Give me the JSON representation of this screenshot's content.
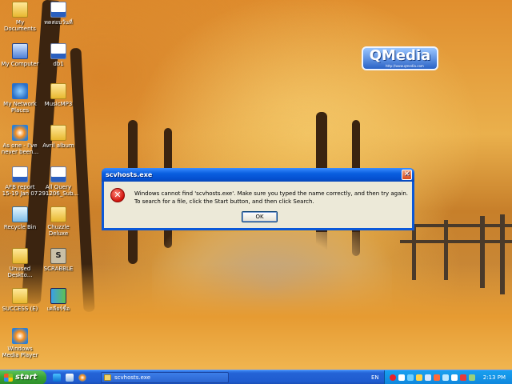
{
  "desktop": {
    "icons_left": [
      {
        "label": "My Documents",
        "icon": "folder-icon"
      },
      {
        "label": "My Computer",
        "icon": "computer-icon"
      },
      {
        "label": "My Network Places",
        "icon": "network-icon"
      },
      {
        "label": "As one - I've never been...",
        "icon": "media-file-icon"
      },
      {
        "label": "AFB report 15-19 Jan 07",
        "icon": "document-icon"
      },
      {
        "label": "Recycle Bin",
        "icon": "recycle-bin-icon"
      },
      {
        "label": "Unused Deskto...",
        "icon": "folder-icon"
      },
      {
        "label": "SUCCESS (E)",
        "icon": "folder-icon"
      },
      {
        "label": "Windows Media Player",
        "icon": "windows-media-player-icon"
      }
    ],
    "icons_right": [
      {
        "label": "ทดสอบวันที่",
        "icon": "document-icon"
      },
      {
        "label": "db1",
        "icon": "document-icon"
      },
      {
        "label": "MusicMP3",
        "icon": "folder-icon"
      },
      {
        "label": "Avril album",
        "icon": "folder-icon"
      },
      {
        "label": "All Query 291206_Sub...",
        "icon": "document-icon"
      },
      {
        "label": "Chuzzle Deluxe",
        "icon": "folder-icon"
      },
      {
        "label": "SCRABBLE",
        "icon": "scrabble-icon"
      },
      {
        "label": "เคลียร์ชื่อ",
        "icon": "app-icon"
      }
    ],
    "logo": {
      "text": "QMedia",
      "subtext": "http://www.qmedia.com"
    }
  },
  "dialog": {
    "title": "scvhosts.exe",
    "message": "Windows cannot find 'scvhosts.exe'. Make sure you typed the name correctly, and then try again. To search for a file, click the Start button, and then click Search.",
    "ok_label": "OK",
    "close_glyph": "✕",
    "error_glyph": "✕"
  },
  "taskbar": {
    "start_label": "start",
    "task_label": "scvhosts.exe",
    "language": "EN",
    "clock": "2:13 PM"
  },
  "colors": {
    "title_bar": "#0a5fe0",
    "start_green": "#3aa435",
    "taskbar_blue": "#2463d6",
    "tray_blue": "#0f86dc",
    "dialog_bg": "#ece9d8"
  }
}
